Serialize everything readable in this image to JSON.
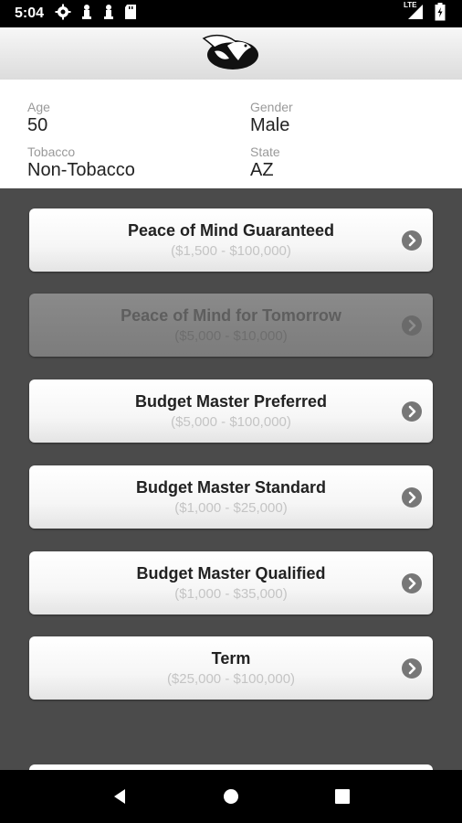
{
  "status_bar": {
    "time": "5:04",
    "network": "LTE"
  },
  "icons": {
    "settings": "gear-icon",
    "logo": "eagle-logo"
  },
  "client": {
    "age_label": "Age",
    "age_value": "50",
    "gender_label": "Gender",
    "gender_value": "Male",
    "tobacco_label": "Tobacco",
    "tobacco_value": "Non-Tobacco",
    "state_label": "State",
    "state_value": "AZ"
  },
  "products": [
    {
      "name": "Peace of Mind Guaranteed",
      "range": "($1,500 - $100,000)",
      "enabled": true
    },
    {
      "name": "Peace of Mind for Tomorrow",
      "range": "($5,000 - $10,000)",
      "enabled": false
    },
    {
      "name": "Budget Master Preferred",
      "range": "($5,000 - $100,000)",
      "enabled": true
    },
    {
      "name": "Budget Master Standard",
      "range": "($1,000 - $25,000)",
      "enabled": true
    },
    {
      "name": "Budget Master Qualified",
      "range": "($1,000 - $35,000)",
      "enabled": true
    },
    {
      "name": "Term",
      "range": "($25,000 - $100,000)",
      "enabled": true
    }
  ]
}
